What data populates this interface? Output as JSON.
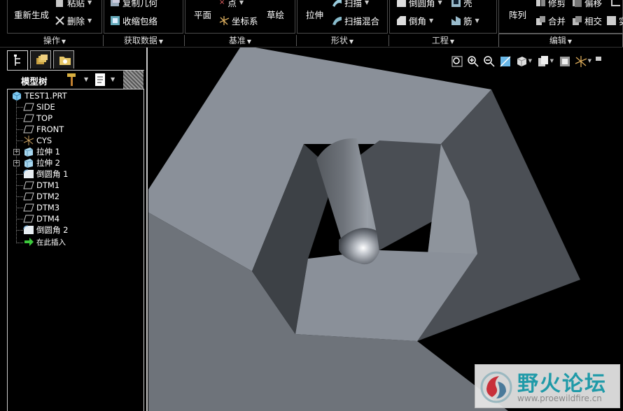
{
  "ribbon": {
    "buttons": {
      "regenerate": "重新生成",
      "paste": "粘贴",
      "delete": "删除",
      "copy_geometry": "复制几何",
      "shrinkwrap": "收缩包络",
      "plane": "平面",
      "point": "点",
      "coordinate_system": "坐标系",
      "sketch": "草绘",
      "extrude": "拉伸",
      "sweep": "扫描",
      "swept_blend": "扫描混合",
      "round": "倒圆角",
      "shell": "壳",
      "chamfer": "倒角",
      "rib": "筋",
      "pattern": "阵列",
      "mirror": "修剪",
      "offset": "偏移",
      "merge": "合并",
      "intersect": "相交",
      "extra": "实"
    },
    "groups": {
      "operations": "操作",
      "get_data": "获取数据",
      "datum": "基准",
      "shapes": "形状",
      "engineering": "工程",
      "editing": "编辑"
    }
  },
  "panel": {
    "title": "模型树"
  },
  "tree": {
    "items": [
      {
        "label": "TEST1.PRT",
        "icon": "part-icon"
      },
      {
        "label": "SIDE",
        "icon": "datum-plane-icon"
      },
      {
        "label": "TOP",
        "icon": "datum-plane-icon"
      },
      {
        "label": "FRONT",
        "icon": "datum-plane-icon"
      },
      {
        "label": "CYS",
        "icon": "coordinate-system-icon"
      },
      {
        "label": "拉伸 1",
        "icon": "extrude-icon"
      },
      {
        "label": "拉伸 2",
        "icon": "extrude-icon"
      },
      {
        "label": "倒圆角 1",
        "icon": "round-icon"
      },
      {
        "label": "DTM1",
        "icon": "datum-plane-icon"
      },
      {
        "label": "DTM2",
        "icon": "datum-plane-icon"
      },
      {
        "label": "DTM3",
        "icon": "datum-plane-icon"
      },
      {
        "label": "DTM4",
        "icon": "datum-plane-icon"
      },
      {
        "label": "倒圆角 2",
        "icon": "round-icon"
      },
      {
        "label": "在此插入",
        "icon": "insert-here-icon"
      }
    ]
  },
  "watermark": {
    "title": "野火论坛",
    "url": "www.proewildfire.cn"
  },
  "colors": {
    "background": "#000000",
    "model_light": "#8a9099",
    "model_dark": "#4b4f55",
    "watermark_accent": "#1f9aa8"
  }
}
